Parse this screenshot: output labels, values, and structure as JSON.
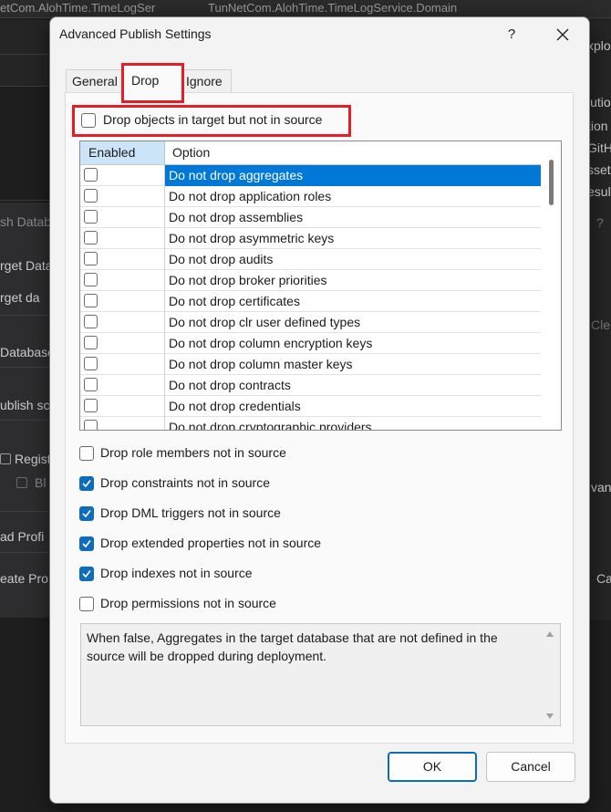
{
  "background": {
    "tabs": [
      "etCom.AlohTime.TimeLogSer",
      "TunNetCom.AlohTime.TimeLogService.Domain"
    ],
    "left_items": [
      "sh Datab",
      "rget Data",
      "rget da",
      "Database",
      "ublish sc",
      "Regist",
      "Bl",
      "ad Profi",
      "eate Pro"
    ],
    "right_items": [
      "xplo",
      "lutio",
      "tion",
      "GitH",
      "sset",
      "esul",
      "?",
      "Cle",
      "van",
      "Ca"
    ]
  },
  "dialog": {
    "title": "Advanced Publish Settings",
    "help_label": "?",
    "tabs": {
      "general": "General",
      "drop": "Drop",
      "ignore": "Ignore"
    },
    "drop_objects": {
      "label": "Drop objects in target but not in source",
      "checked": false
    },
    "grid": {
      "headers": {
        "enabled": "Enabled",
        "option": "Option"
      },
      "rows": [
        {
          "option": "Do not drop aggregates",
          "enabled": false,
          "selected": true
        },
        {
          "option": "Do not drop application roles",
          "enabled": false
        },
        {
          "option": "Do not drop assemblies",
          "enabled": false
        },
        {
          "option": "Do not drop asymmetric keys",
          "enabled": false
        },
        {
          "option": "Do not drop audits",
          "enabled": false
        },
        {
          "option": "Do not drop broker priorities",
          "enabled": false
        },
        {
          "option": "Do not drop certificates",
          "enabled": false
        },
        {
          "option": "Do not drop clr user defined types",
          "enabled": false
        },
        {
          "option": "Do not drop column encryption keys",
          "enabled": false
        },
        {
          "option": "Do not drop column master keys",
          "enabled": false
        },
        {
          "option": "Do not drop contracts",
          "enabled": false
        },
        {
          "option": "Do not drop credentials",
          "enabled": false
        },
        {
          "option": "Do not drop cryptographic providers",
          "enabled": false
        }
      ]
    },
    "options": [
      {
        "label": "Drop role members not in source",
        "checked": false
      },
      {
        "label": "Drop constraints not in source",
        "checked": true
      },
      {
        "label": "Drop DML triggers not in source",
        "checked": true
      },
      {
        "label": "Drop extended properties not in source",
        "checked": true
      },
      {
        "label": "Drop indexes not in source",
        "checked": true
      },
      {
        "label": "Drop permissions not in source",
        "checked": false
      }
    ],
    "description": "When false, Aggregates in the target database that are not defined in the source will be dropped during deployment.",
    "buttons": {
      "ok": "OK",
      "cancel": "Cancel"
    }
  },
  "colors": {
    "accent": "#0f6cbd",
    "selection": "#0078d7",
    "highlight_box": "#e41e26"
  }
}
